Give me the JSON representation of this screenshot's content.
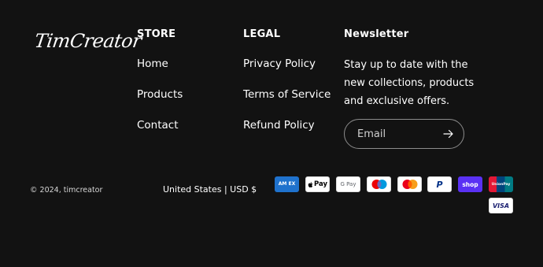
{
  "brand": {
    "logo_text": "TimCreator"
  },
  "store": {
    "heading": "STORE",
    "links": [
      "Home",
      "Products",
      "Contact"
    ]
  },
  "legal": {
    "heading": "LEGAL",
    "links": [
      "Privacy Policy",
      "Terms of Service",
      "Refund Policy"
    ]
  },
  "newsletter": {
    "heading": "Newsletter",
    "text": "Stay up to date with the new collections, products and exclusive offers.",
    "email_placeholder": "Email",
    "submit_icon": "arrow-right-icon"
  },
  "footer": {
    "copyright": "© 2024, timcreator",
    "locale": "United States | USD $"
  },
  "payments": [
    {
      "name": "amex",
      "label": "AM EX",
      "bg": "#1f72cd",
      "fg": "#ffffff"
    },
    {
      "name": "apple-pay",
      "label": "Pay",
      "bg": "#ffffff",
      "fg": "#000000"
    },
    {
      "name": "google-pay",
      "label": "G Pay",
      "bg": "#ffffff",
      "fg": "#5f6368"
    },
    {
      "name": "maestro",
      "label": "",
      "bg": "#ffffff",
      "fg": "#000000"
    },
    {
      "name": "mastercard",
      "label": "",
      "bg": "#ffffff",
      "fg": "#000000"
    },
    {
      "name": "paypal",
      "label": "P",
      "bg": "#ffffff",
      "fg": "#003087"
    },
    {
      "name": "shop-pay",
      "label": "shop",
      "bg": "#5a31f4",
      "fg": "#ffffff"
    },
    {
      "name": "unionpay",
      "label": "UnionPay",
      "bg": "#1a8a8a",
      "fg": "#ffffff"
    },
    {
      "name": "visa",
      "label": "VISA",
      "bg": "#ffffff",
      "fg": "#1a1f71"
    }
  ]
}
